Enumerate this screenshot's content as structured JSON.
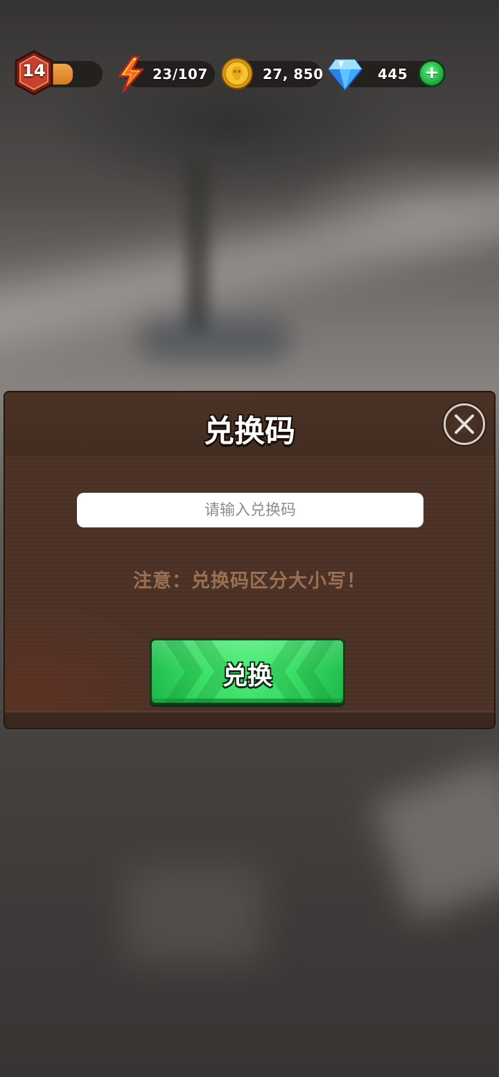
{
  "hud": {
    "level": "14",
    "level_progress": 0.45,
    "energy": "23/107",
    "gold": "27, 850",
    "gems": "445",
    "add_label": "+",
    "icons": [
      "level-hex-badge",
      "lightning-icon",
      "skull-coin-icon",
      "diamond-icon",
      "plus-icon"
    ]
  },
  "dialog": {
    "title": "兑换码",
    "input_placeholder": "请输入兑换码",
    "input_value": "",
    "note": "注意：兑换码区分大小写！",
    "redeem_label": "兑换"
  },
  "colors": {
    "dialog_bg": "#4c3226",
    "header_bg": "#4a3225",
    "note_text": "#9a7253",
    "button_green": "#3fe46a",
    "level_fill": "#e8903a"
  }
}
